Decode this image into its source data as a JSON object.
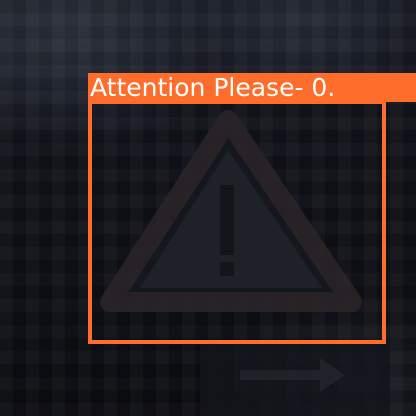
{
  "detection": {
    "label_text": "Attention Please- 0.",
    "box_color": "#ff6d2c",
    "label_text_color": "#ffffff"
  },
  "scene": {
    "object_icon": "warning-triangle-sign-icon",
    "secondary_icon": "arrow-sign-icon"
  }
}
